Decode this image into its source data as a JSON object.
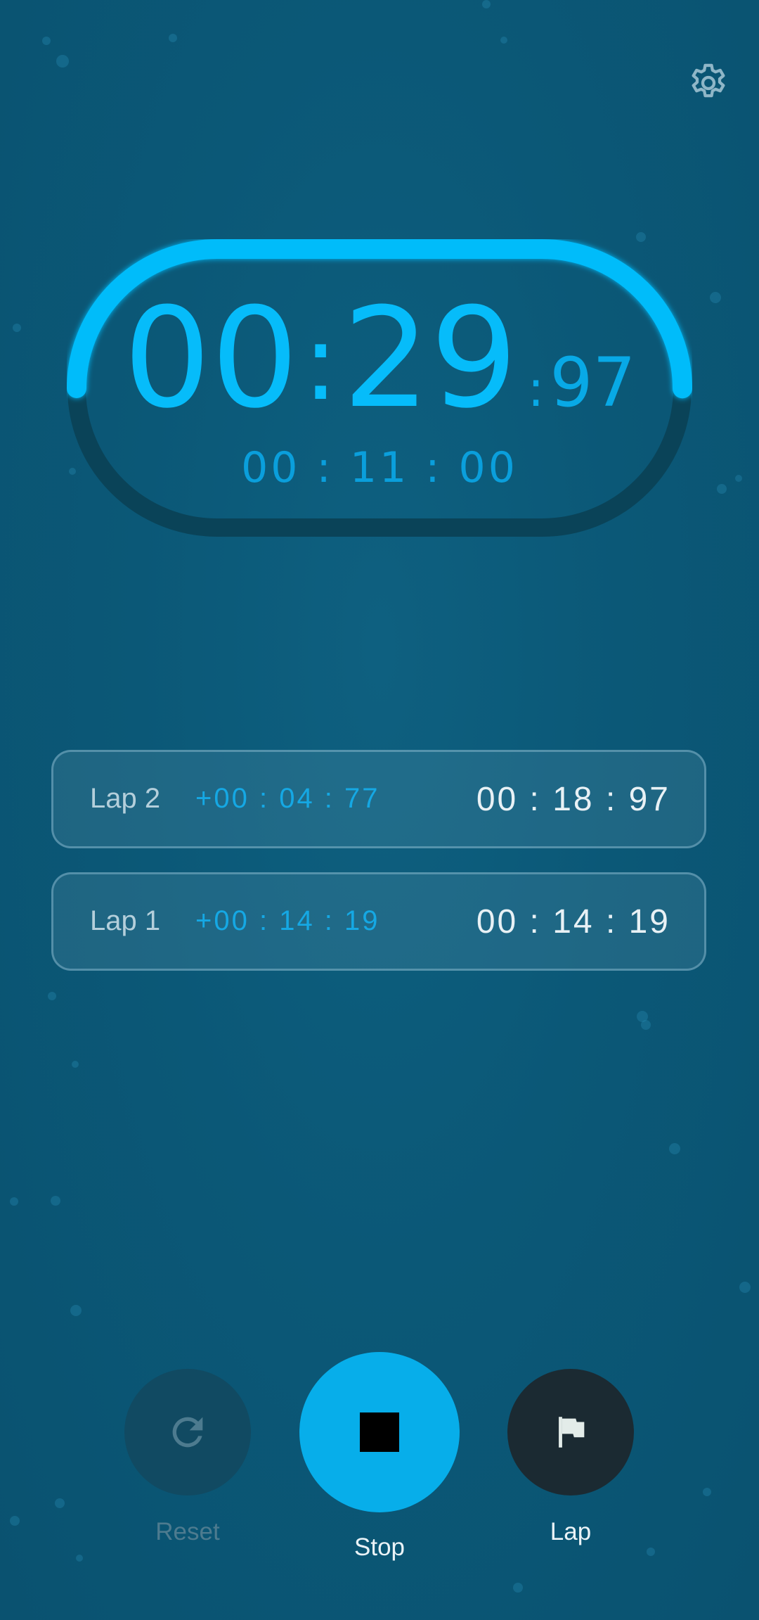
{
  "header": {
    "settings_icon": "gear-icon"
  },
  "timer": {
    "minutes": "00",
    "seconds": "29",
    "hundredths": "97",
    "separator": ":",
    "countdown": "00 : 11 : 00",
    "progress": 0.5
  },
  "laps": [
    {
      "label": "Lap 2",
      "diff": "+00 : 04 : 77",
      "total": "00 : 18 : 97"
    },
    {
      "label": "Lap 1",
      "diff": "+00 : 14 : 19",
      "total": "00 : 14 : 19"
    }
  ],
  "controls": {
    "reset_label": "Reset",
    "stop_label": "Stop",
    "lap_label": "Lap",
    "reset_icon": "refresh-icon",
    "stop_icon": "stop-icon",
    "lap_icon": "flag-icon"
  },
  "colors": {
    "accent": "#06bcfa",
    "background": "#0b5877",
    "stop_button": "#07aeea",
    "lap_button": "#1b2a32"
  }
}
